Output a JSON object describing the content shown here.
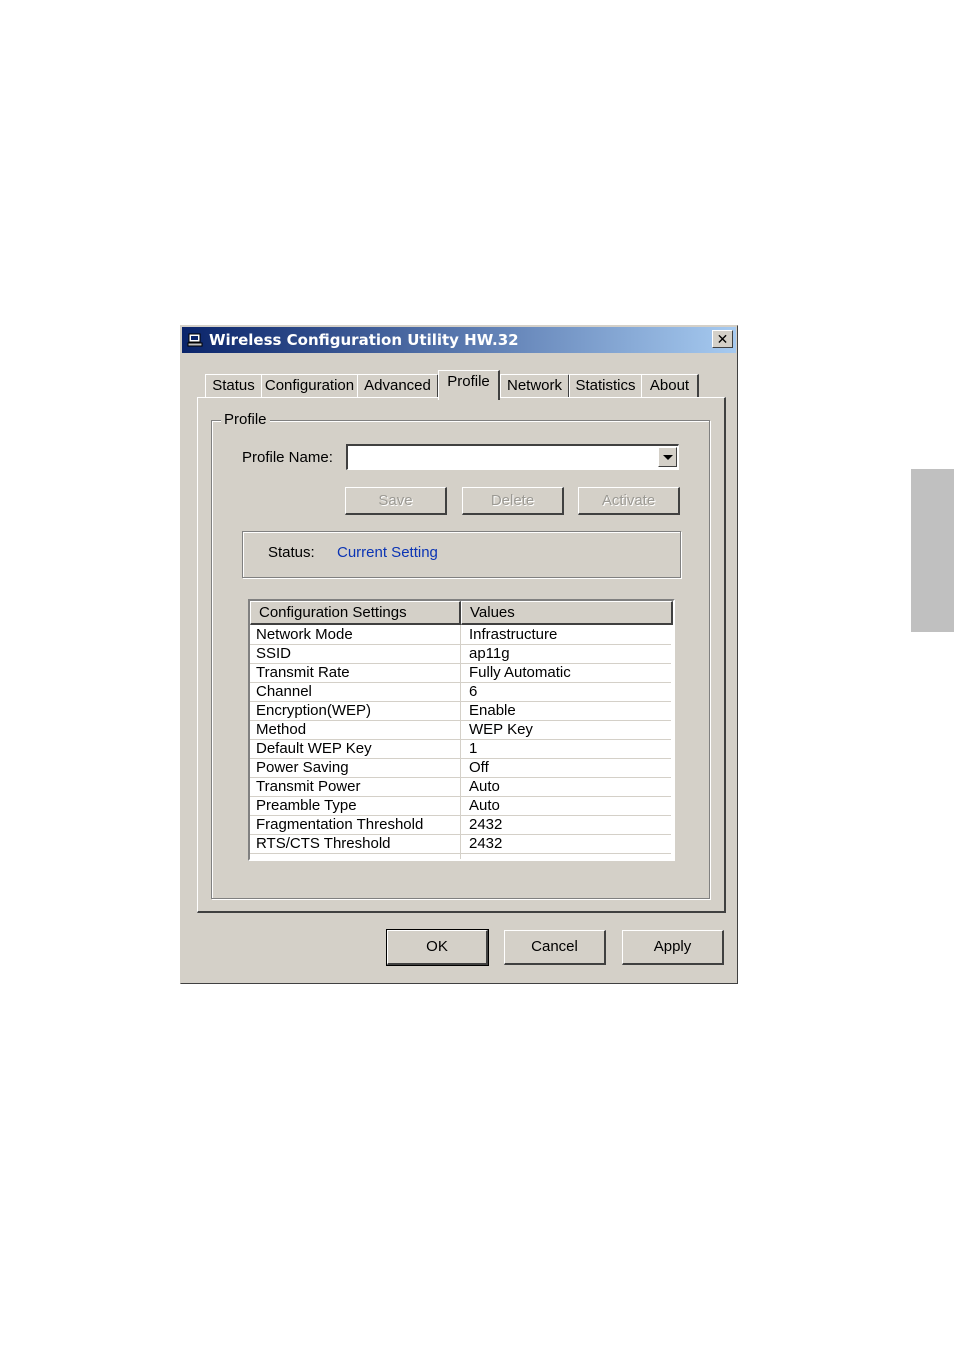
{
  "window": {
    "title": "Wireless Configuration Utility HW.32",
    "close_glyph": "✕"
  },
  "tabs": [
    {
      "label": "Status",
      "active": false
    },
    {
      "label": "Configuration",
      "active": false
    },
    {
      "label": "Advanced",
      "active": false
    },
    {
      "label": "Profile",
      "active": true
    },
    {
      "label": "Network",
      "active": false
    },
    {
      "label": "Statistics",
      "active": false
    },
    {
      "label": "About",
      "active": false
    }
  ],
  "profile": {
    "group_label": "Profile",
    "name_label": "Profile Name:",
    "name_value": "",
    "save_label": "Save",
    "delete_label": "Delete",
    "activate_label": "Activate",
    "status_label": "Status:",
    "status_value": "Current Setting"
  },
  "settings_table": {
    "headers": [
      "Configuration Settings",
      "Values"
    ],
    "rows": [
      [
        "Network Mode",
        "Infrastructure"
      ],
      [
        "SSID",
        "ap11g"
      ],
      [
        "Transmit Rate",
        "Fully Automatic"
      ],
      [
        "Channel",
        "6"
      ],
      [
        "Encryption(WEP)",
        "Enable"
      ],
      [
        "Method",
        "WEP Key"
      ],
      [
        "Default WEP Key",
        "1"
      ],
      [
        "Power Saving",
        "Off"
      ],
      [
        "Transmit Power",
        "Auto"
      ],
      [
        "Preamble Type",
        "Auto"
      ],
      [
        "Fragmentation Threshold",
        "2432"
      ],
      [
        "RTS/CTS Threshold",
        "2432"
      ]
    ]
  },
  "footer": {
    "ok_label": "OK",
    "cancel_label": "Cancel",
    "apply_label": "Apply"
  },
  "colors": {
    "dialog_bg": "#d4d0c8",
    "title_gradient_start": "#0a246a",
    "title_gradient_end": "#a6caf0",
    "status_value": "#0b34b4"
  }
}
